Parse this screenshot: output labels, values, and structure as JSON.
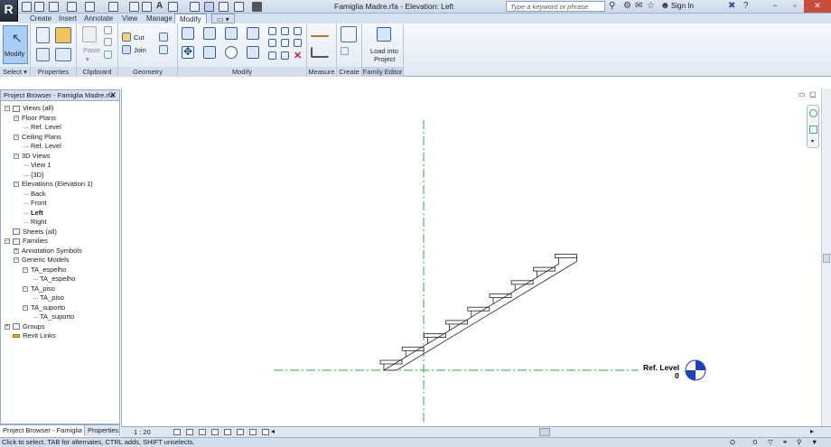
{
  "window": {
    "title": "Famiglia Madre.rfa - Elevation: Left",
    "search_placeholder": "Type a keyword or phrase",
    "sign_in": "Sign In"
  },
  "tabs": [
    "Create",
    "Insert",
    "Annotate",
    "View",
    "Manage",
    "Modify"
  ],
  "active_tab": "Modify",
  "ribbon": {
    "select_label": "Modify",
    "paste_label": "Paste",
    "cut_label": "Cut",
    "join_label": "Join",
    "load_label_1": "Load into",
    "load_label_2": "Project",
    "panels": {
      "select": "Select",
      "properties": "Properties",
      "clipboard": "Clipboard",
      "geometry": "Geometry",
      "modify": "Modify",
      "measure": "Measure",
      "create": "Create",
      "family_editor": "Family Editor"
    }
  },
  "project_browser": {
    "title": "Project Browser - Famiglia Madre.rfa",
    "close": "✕",
    "tree": [
      {
        "label": "Views (all)",
        "level": 0,
        "expand": "-",
        "icon": true
      },
      {
        "label": "Floor Plans",
        "level": 1,
        "expand": "-"
      },
      {
        "label": "Ref. Level",
        "level": 2
      },
      {
        "label": "Ceiling Plans",
        "level": 1,
        "expand": "-"
      },
      {
        "label": "Ref. Level",
        "level": 2
      },
      {
        "label": "3D Views",
        "level": 1,
        "expand": "-"
      },
      {
        "label": "View 1",
        "level": 2
      },
      {
        "label": "{3D}",
        "level": 2
      },
      {
        "label": "Elevations (Elevation 1)",
        "level": 1,
        "expand": "-"
      },
      {
        "label": "Back",
        "level": 2
      },
      {
        "label": "Front",
        "level": 2
      },
      {
        "label": "Left",
        "level": 2,
        "bold": true
      },
      {
        "label": "Right",
        "level": 2
      },
      {
        "label": "Sheets (all)",
        "level": 0,
        "icon": true
      },
      {
        "label": "Families",
        "level": 0,
        "expand": "-",
        "icon": true
      },
      {
        "label": "Annotation Symbols",
        "level": 1,
        "expand": "+"
      },
      {
        "label": "Generic Models",
        "level": 1,
        "expand": "-"
      },
      {
        "label": "TA_espelho",
        "level": 2,
        "expand": "-"
      },
      {
        "label": "TA_espelho",
        "level": 3
      },
      {
        "label": "TA_piso",
        "level": 2,
        "expand": "-"
      },
      {
        "label": "TA_piso",
        "level": 3
      },
      {
        "label": "TA_suporto",
        "level": 2,
        "expand": "-"
      },
      {
        "label": "TA_suporto",
        "level": 3
      },
      {
        "label": "Groups",
        "level": 0,
        "expand": "+",
        "icon": true
      },
      {
        "label": "Revit Links",
        "level": 0,
        "icon": true
      }
    ],
    "tab_browser": "Project Browser - Famiglia M...",
    "tab_properties": "Properties"
  },
  "view": {
    "level_name": "Ref. Level",
    "level_value": "0",
    "scale": "1 : 20"
  },
  "status": {
    "message": "Click to select, TAB for alternates, CTRL adds, SHIFT unselects.",
    "right_value": ":0"
  },
  "colors": {
    "ref_plane": "#2fa83a",
    "level_marker": "#1f3fbf",
    "ribbon_select": "#a9cdf5"
  }
}
